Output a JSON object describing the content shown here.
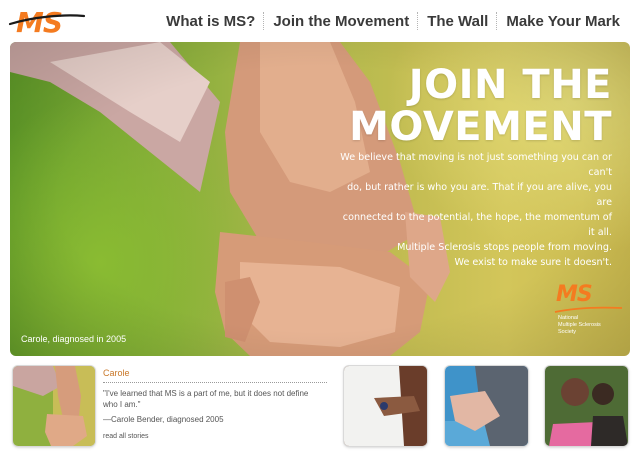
{
  "header": {
    "logo_text": "MS",
    "nav": [
      {
        "label": "What is MS?"
      },
      {
        "label": "Join the Movement"
      },
      {
        "label": "The Wall"
      },
      {
        "label": "Make Your Mark"
      }
    ]
  },
  "hero": {
    "title_line1": "JOIN THE",
    "title_line2": "MOVEMENT",
    "body": [
      "We believe that moving is not just something you can or can't",
      "do, but rather is who you are. That if you are alive, you are",
      "connected to the potential, the hope, the momentum of it all.",
      "Multiple Sclerosis stops people from moving.",
      "We exist to make sure it doesn't."
    ],
    "caption": "Carole, diagnosed in 2005",
    "logo": {
      "mark": "MS",
      "line1": "National",
      "line2": "Multiple Sclerosis",
      "line3": "Society"
    }
  },
  "story": {
    "name": "Carole",
    "quote_line1": "\"I've learned that MS is a part of me, but it does not define",
    "quote_line2": "who I am.\"",
    "author": "—Carole Bender, diagnosed 2005",
    "link": "read all stories"
  },
  "colors": {
    "accent": "#f47b20",
    "nav_text": "#3a3a3a",
    "story_name": "#c9782a"
  }
}
